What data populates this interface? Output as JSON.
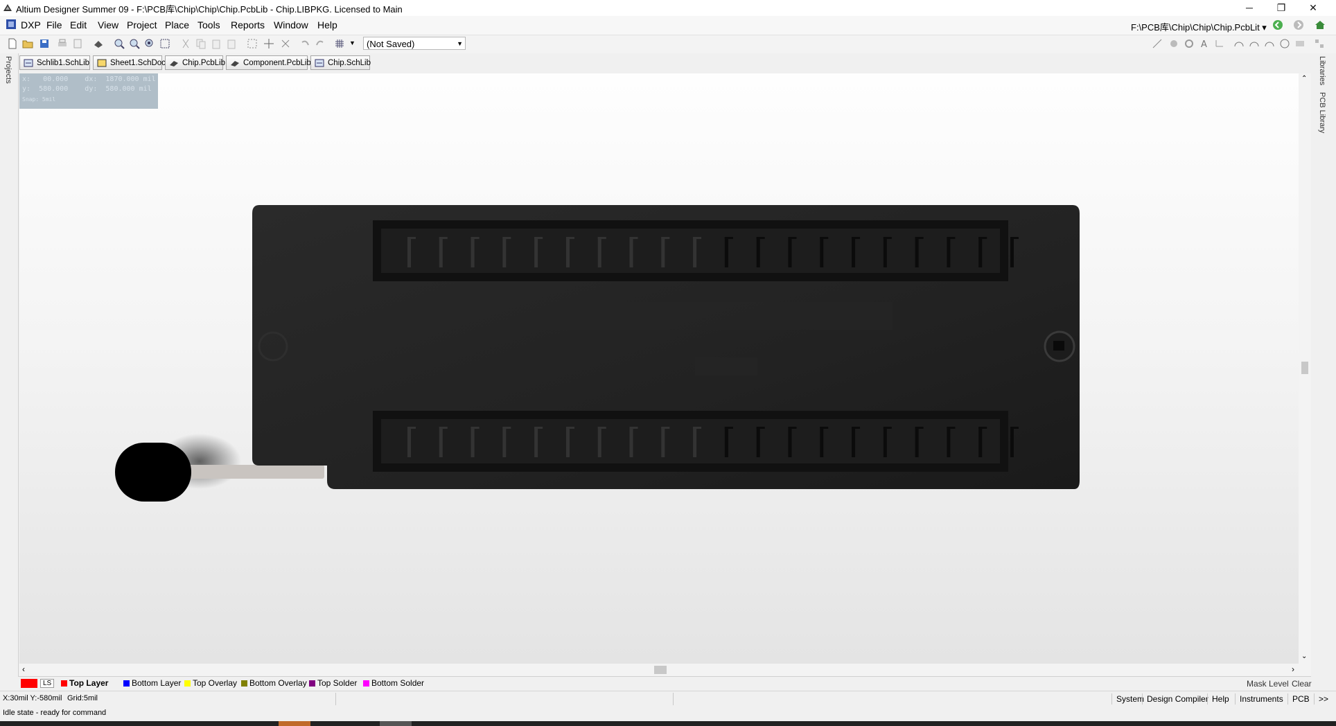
{
  "window": {
    "title": "Altium Designer Summer 09 - F:\\PCB库\\Chip\\Chip\\Chip.PcbLib - Chip.LIBPKG. Licensed to Main",
    "minimize": "─",
    "restore": "❐",
    "close": "✕"
  },
  "menu": {
    "dxp": "DXP",
    "items": [
      "File",
      "Edit",
      "View",
      "Project",
      "Place",
      "Tools",
      "Reports",
      "Window",
      "Help"
    ],
    "path_selector": "F:\\PCB库\\Chip\\Chip\\Chip.PcbLit ▾"
  },
  "toolbar": {
    "view_state": "(Not Saved)"
  },
  "doc_tabs": [
    "Schlib1.SchLib",
    "Sheet1.SchDoc",
    "Chip.PcbLib",
    "Component.PcbLib",
    "Chip.SchLib"
  ],
  "side_panels": {
    "left": "Projects",
    "right": [
      "Libraries",
      "PCB Library"
    ]
  },
  "info_box": {
    "line1": "x:   00.000    dx:  1870.000 mil",
    "line2": "y:  580.000    dy:  580.000 mil",
    "line3": "Snap: 5mil"
  },
  "layers": {
    "ls": "LS",
    "active": "Top Layer",
    "items": [
      {
        "name": "Top Layer",
        "color": "#ff0000"
      },
      {
        "name": "Bottom Layer",
        "color": "#0000ff"
      },
      {
        "name": "Top Overlay",
        "color": "#ffff00"
      },
      {
        "name": "Bottom Overlay",
        "color": "#808000"
      },
      {
        "name": "Top Solder",
        "color": "#800080"
      },
      {
        "name": "Bottom Solder",
        "color": "#ff00ff"
      }
    ],
    "mask_level": "Mask Level",
    "clear": "Clear"
  },
  "status": {
    "coords": "X:30mil Y:-580mil",
    "grid": "Grid:5mil",
    "idle": "Idle state - ready for command",
    "buttons": [
      "System",
      "Design Compiler",
      "Help",
      "Instruments",
      "PCB",
      ">>"
    ]
  },
  "model": {
    "body_color": "#222222",
    "lever_color": "#000000"
  }
}
